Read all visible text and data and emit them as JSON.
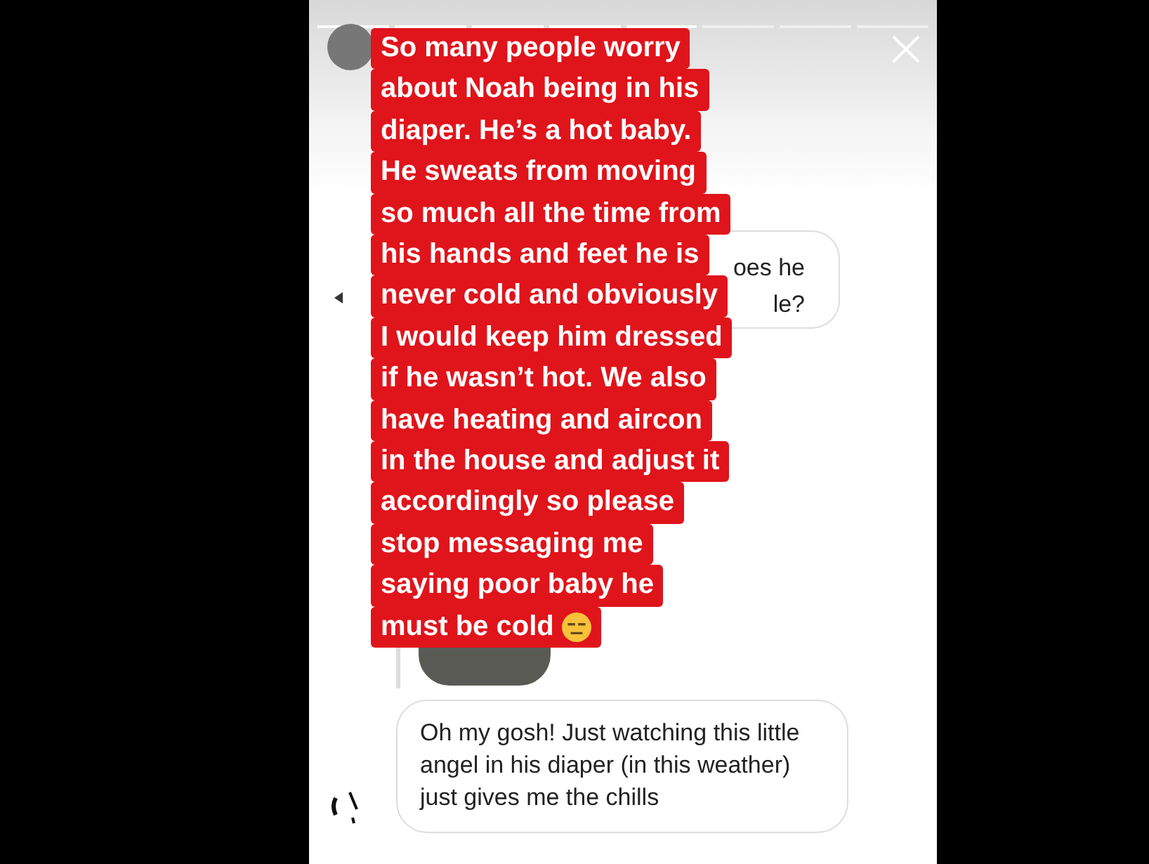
{
  "story": {
    "caption_lines": [
      "So many people worry",
      "about Noah being in his",
      "diaper. He’s a hot baby.",
      "He sweats from moving",
      "so much all the time from",
      "his hands and feet he is",
      "never cold and obviously",
      "I would keep him dressed",
      "if he wasn’t hot. We also",
      "have heating and aircon",
      "in the house and adjust it",
      "accordingly so please",
      "stop messaging me",
      "saying poor baby he",
      "must be cold"
    ],
    "partial_message_lines": [
      "oes he",
      "le?"
    ],
    "message": "Oh my gosh! Just watching this little angel in his diaper (in this weather) just gives me the chills"
  }
}
